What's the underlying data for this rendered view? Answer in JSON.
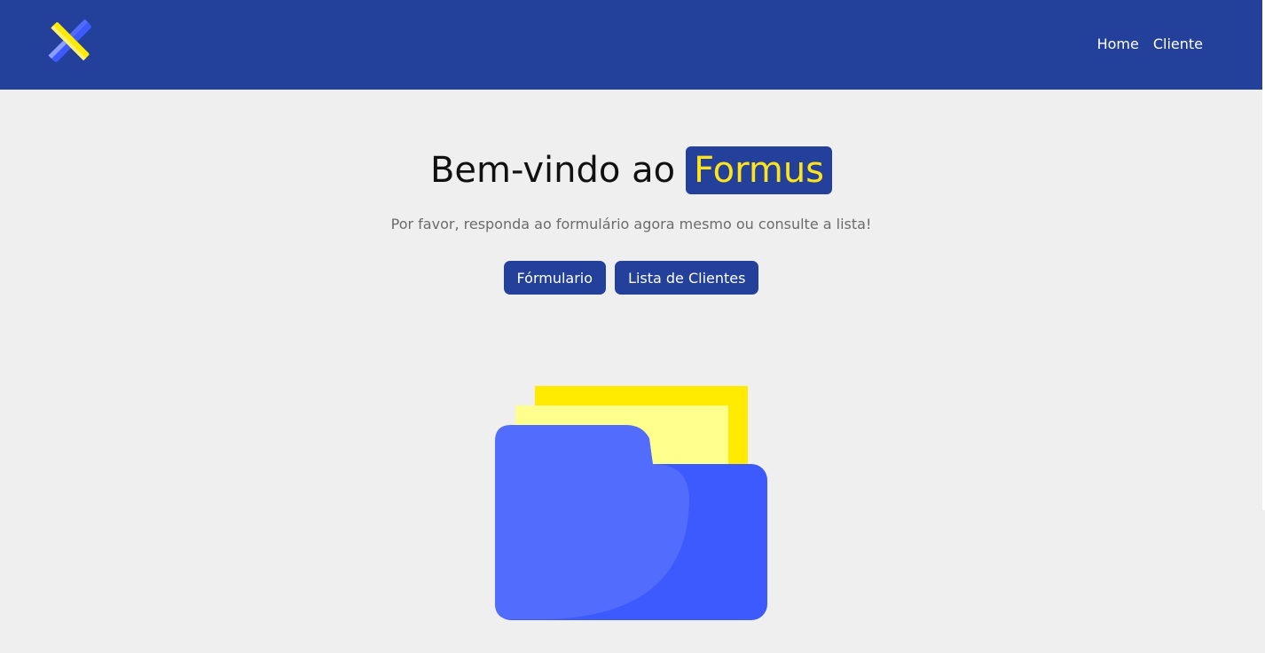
{
  "navbar": {
    "logo_icon": "pencil-ruler-cross-icon",
    "links": [
      {
        "label": "Home"
      },
      {
        "label": "Cliente"
      }
    ]
  },
  "hero": {
    "title_prefix": "Bem-vindo ao",
    "brand": "Formus",
    "subtitle": "Por favor, responda ao formulário agora mesmo ou consulte a lista!",
    "buttons": [
      {
        "label": "Fórmulario"
      },
      {
        "label": "Lista de Clientes"
      }
    ]
  },
  "illustration": {
    "icon": "open-folder-with-papers-icon"
  },
  "colors": {
    "primary": "#23419a",
    "accent_yellow": "#ffe41a",
    "background": "#efefef",
    "folder_front": "#526dfd",
    "folder_back": "#3d5afe",
    "paper_back": "#ffea00",
    "paper_front": "#ffff8d"
  }
}
